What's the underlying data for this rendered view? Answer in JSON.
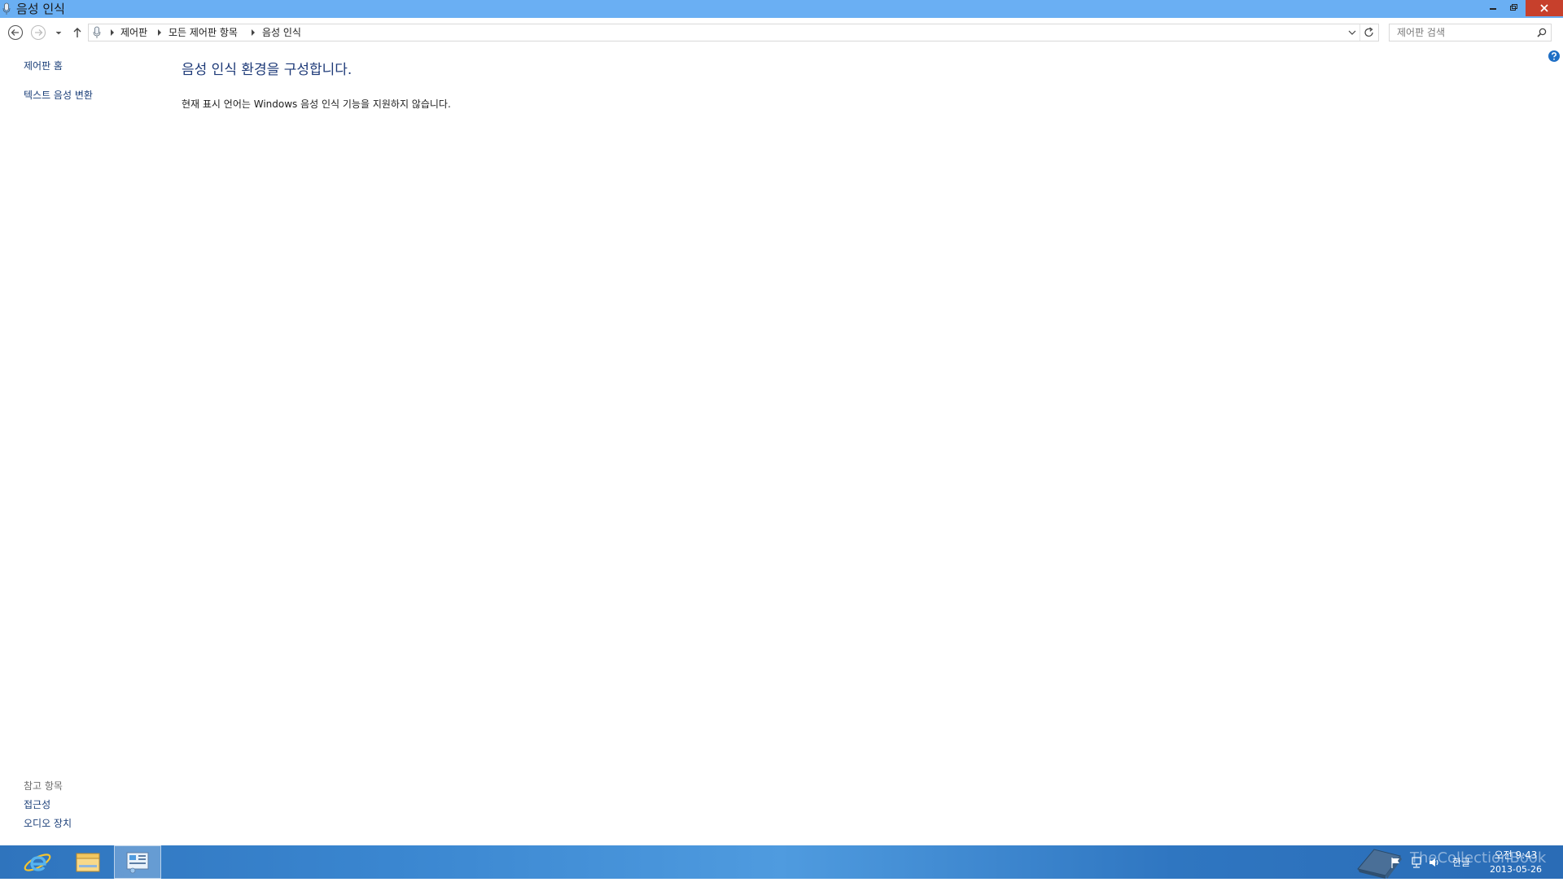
{
  "window": {
    "title": "음성 인식",
    "accent": "#6aaff3",
    "close_color": "#c7402c"
  },
  "nav": {
    "back_icon": "back-arrow-icon",
    "forward_icon": "forward-arrow-icon",
    "recent_icon": "chevron-down-icon",
    "up_icon": "up-arrow-icon"
  },
  "address": {
    "crumbs": [
      "제어판",
      "모든 제어판 항목",
      "음성 인식"
    ]
  },
  "search": {
    "placeholder": "제어판 검색"
  },
  "left_pane": {
    "home_link": "제어판 홈",
    "tts_link": "텍스트 음성 변환",
    "see_also_label": "참고 항목",
    "see_also_links": [
      "접근성",
      "오디오 장치"
    ]
  },
  "main": {
    "heading": "음성 인식 환경을 구성합니다.",
    "message": "현재 표시 언어는 Windows 음성 인식 기능을 지원하지 않습니다."
  },
  "taskbar": {
    "ime_label": "한글",
    "time": "오전 9:43",
    "date": "2013-05-26",
    "watermark": "TheCollectionBook"
  }
}
